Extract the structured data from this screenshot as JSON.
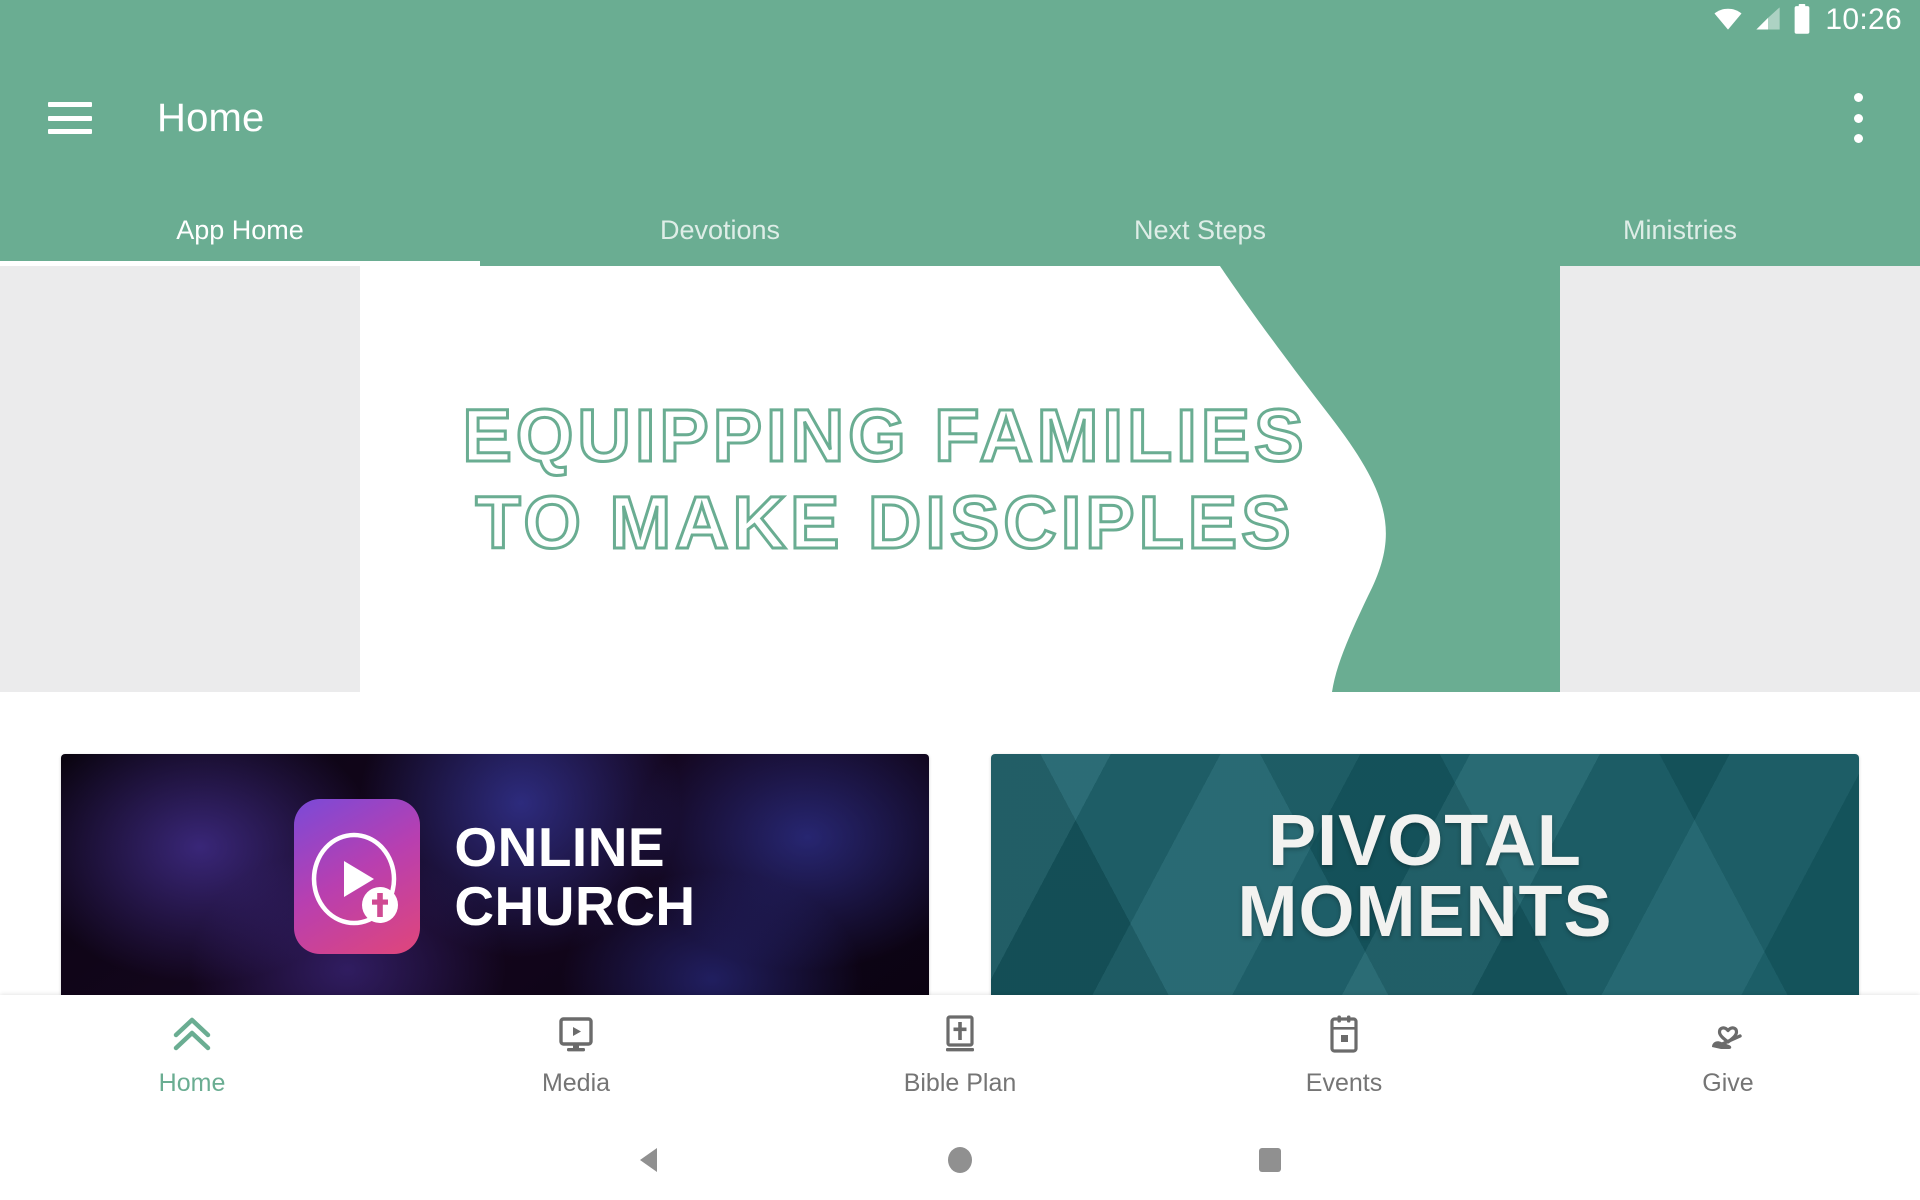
{
  "theme": {
    "brand_green": "#6aad92",
    "hero_outline_green": "#6aad92",
    "hero_side_bg": "#ebebec",
    "pivotal_teal": "#175e68",
    "online_church_dark": "#0b0312",
    "bottom_nav_inactive": "#757575",
    "bottom_nav_active": "#6aad92",
    "system_nav_icon": "#909090"
  },
  "status_bar": {
    "clock": "10:26",
    "icons": [
      "wifi-icon",
      "cell-signal-icon",
      "battery-icon"
    ]
  },
  "app_bar": {
    "menu_icon": "hamburger-menu-icon",
    "title": "Home",
    "overflow_icon": "overflow-menu-icon"
  },
  "tabs": {
    "active_index": 0,
    "items": [
      {
        "label": "App Home"
      },
      {
        "label": "Devotions"
      },
      {
        "label": "Next Steps"
      },
      {
        "label": "Ministries"
      }
    ]
  },
  "hero": {
    "line1": "EQUIPPING FAMILIES",
    "line2": "TO MAKE DISCIPLES"
  },
  "promo_cards": [
    {
      "id": "online-church",
      "line1": "ONLINE",
      "line2": "CHURCH",
      "logo_icon": "play-cross-logo-icon"
    },
    {
      "id": "pivotal-moments",
      "line1": "PIVOTAL",
      "line2": "MOMENTS"
    }
  ],
  "bottom_nav": {
    "active_index": 0,
    "items": [
      {
        "label": "Home",
        "icon": "double-chevron-up-icon"
      },
      {
        "label": "Media",
        "icon": "media-monitor-play-icon"
      },
      {
        "label": "Bible Plan",
        "icon": "bible-book-cross-icon"
      },
      {
        "label": "Events",
        "icon": "calendar-icon"
      },
      {
        "label": "Give",
        "icon": "hand-heart-icon"
      }
    ]
  },
  "system_nav": {
    "items": [
      {
        "icon": "android-back-icon"
      },
      {
        "icon": "android-home-icon"
      },
      {
        "icon": "android-recents-icon"
      }
    ]
  }
}
